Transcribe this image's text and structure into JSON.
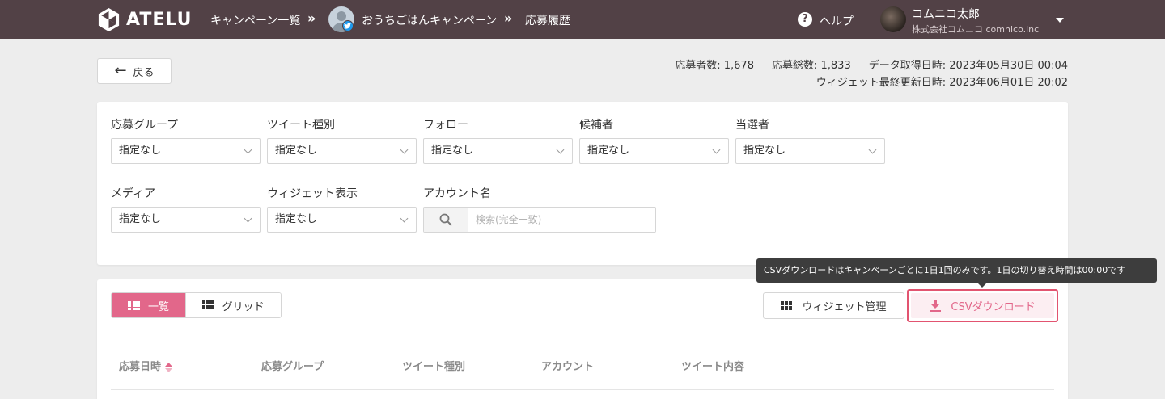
{
  "header": {
    "logo_text": "ATELU",
    "breadcrumbs": [
      "キャンペーン一覧",
      "おうちごはんキャンペーン",
      "応募履歴"
    ],
    "crumb_separator": "»",
    "help_label": "ヘルプ",
    "user_name": "コムニコ太郎",
    "user_company": "株式会社コムニコ comnico.inc",
    "bg_color": "#524146"
  },
  "toolbar": {
    "back_label": "戻る",
    "applicant_count": "応募者数: 1,678",
    "total_entries": "応募総数: 1,833",
    "data_fetched": "データ取得日時: 2023年05月30日 00:04",
    "widget_updated": "ウィジェット最終更新日時: 2023年06月01日 20:02"
  },
  "filters": {
    "row1": [
      {
        "label": "応募グループ",
        "value": "指定なし"
      },
      {
        "label": "ツイート種別",
        "value": "指定なし"
      },
      {
        "label": "フォロー",
        "value": "指定なし"
      },
      {
        "label": "候補者",
        "value": "指定なし"
      },
      {
        "label": "当選者",
        "value": "指定なし"
      }
    ],
    "row2": [
      {
        "label": "メディア",
        "value": "指定なし"
      },
      {
        "label": "ウィジェット表示",
        "value": "指定なし"
      }
    ],
    "account_label": "アカウント名",
    "account_placeholder": "検索(完全一致)"
  },
  "tooltip": {
    "text": "CSVダウンロードはキャンペーンごとに1日1回のみです。1日の切り替え時間は00:00です"
  },
  "list": {
    "view_list_label": "一覧",
    "view_grid_label": "グリッド",
    "widget_manage_label": "ウィジェット管理",
    "csv_download_label": "CSVダウンロード",
    "accent_color": "#e2678a",
    "columns": [
      "応募日時",
      "応募グループ",
      "ツイート種別",
      "アカウント",
      "ツイート内容"
    ]
  }
}
